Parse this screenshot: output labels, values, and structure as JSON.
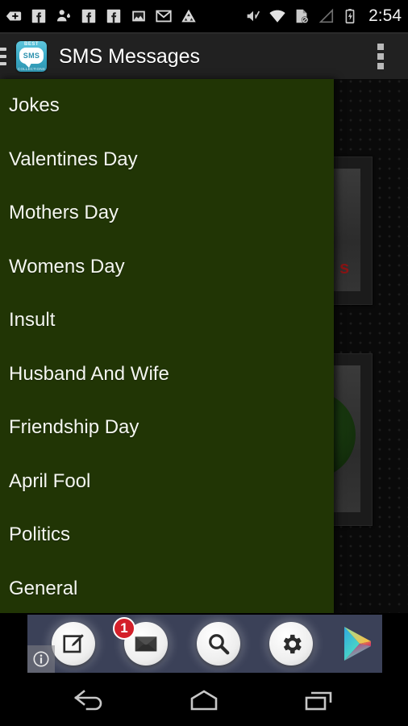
{
  "status_bar": {
    "time": "2:54",
    "icons": [
      {
        "name": "add-tag-icon"
      },
      {
        "name": "facebook-icon"
      },
      {
        "name": "person-add-icon"
      },
      {
        "name": "facebook-icon"
      },
      {
        "name": "facebook-icon"
      },
      {
        "name": "photo-icon"
      },
      {
        "name": "gmail-icon"
      },
      {
        "name": "triangle-app-icon"
      },
      {
        "name": "volume-mute-icon"
      },
      {
        "name": "wifi-icon"
      },
      {
        "name": "sd-card-blocked-icon"
      },
      {
        "name": "signal-no-service-icon"
      },
      {
        "name": "battery-charging-icon"
      }
    ]
  },
  "app_bar": {
    "drawer_toggle": "drawer-toggle",
    "title": "SMS Messages",
    "icon": {
      "top_text": "BEST",
      "badge_text": "SMS",
      "bottom_text": "COLLECTIONS"
    },
    "overflow_label": "overflow-menu"
  },
  "drawer": {
    "background_color": "#213505",
    "text_color": "#f4f6f0",
    "items": [
      {
        "label": "Jokes"
      },
      {
        "label": "Valentines Day"
      },
      {
        "label": "Mothers Day"
      },
      {
        "label": "Womens Day"
      },
      {
        "label": "Insult"
      },
      {
        "label": "Husband And Wife"
      },
      {
        "label": "Friendship Day"
      },
      {
        "label": "April Fool"
      },
      {
        "label": "Politics"
      },
      {
        "label": "General"
      }
    ]
  },
  "background_content": {
    "card_1_text": "s",
    "card_2_name": "green-orb-thumbnail"
  },
  "ad_banner": {
    "background_color": "#3b4158",
    "mail_badge_count": "1",
    "info_label": "i",
    "buttons": [
      {
        "name": "compose-button"
      },
      {
        "name": "mail-button"
      },
      {
        "name": "search-button"
      },
      {
        "name": "settings-button"
      },
      {
        "name": "google-play-button"
      }
    ]
  },
  "nav_bar": {
    "buttons": [
      {
        "name": "back-button"
      },
      {
        "name": "home-button"
      },
      {
        "name": "recents-button"
      }
    ]
  }
}
